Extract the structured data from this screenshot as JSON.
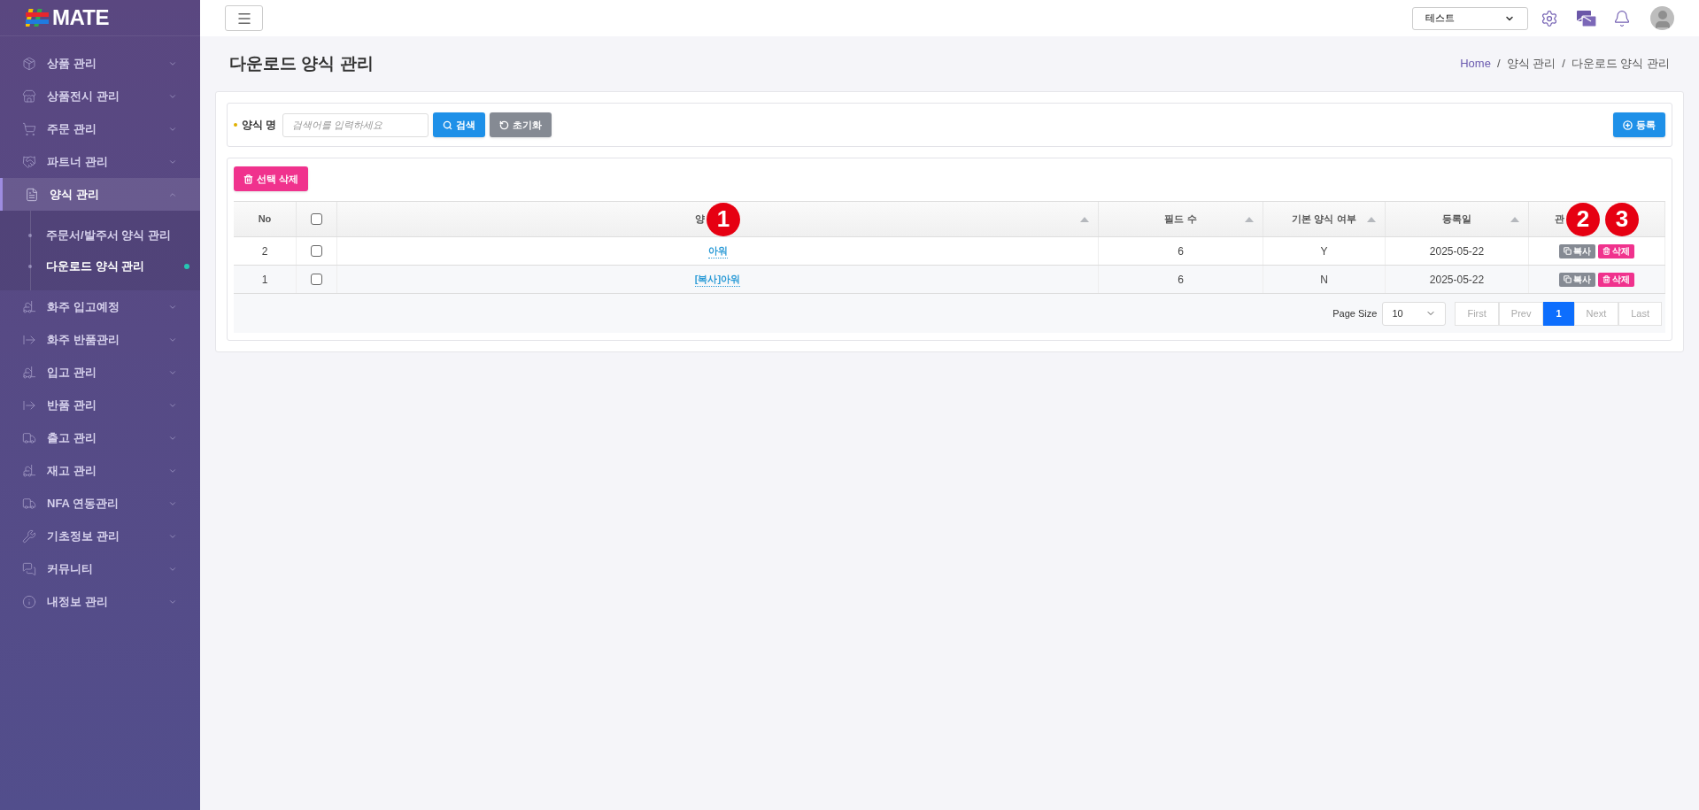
{
  "logo": {
    "text": "MATE"
  },
  "sidebar": {
    "items": [
      {
        "label": "상품 관리",
        "selected": false,
        "expanded": false
      },
      {
        "label": "상품전시 관리",
        "selected": false,
        "expanded": false
      },
      {
        "label": "주문 관리",
        "selected": false,
        "expanded": false
      },
      {
        "label": "파트너 관리",
        "selected": false,
        "expanded": false
      },
      {
        "label": "양식 관리",
        "selected": true,
        "expanded": true,
        "children": [
          {
            "label": "주문서/발주서 양식 관리",
            "selected": false
          },
          {
            "label": "다운로드 양식 관리",
            "selected": true
          }
        ]
      },
      {
        "label": "화주 입고예정",
        "selected": false,
        "expanded": false
      },
      {
        "label": "화주 반품관리",
        "selected": false,
        "expanded": false
      },
      {
        "label": "입고 관리",
        "selected": false,
        "expanded": false
      },
      {
        "label": "반품 관리",
        "selected": false,
        "expanded": false
      },
      {
        "label": "출고 관리",
        "selected": false,
        "expanded": false
      },
      {
        "label": "재고 관리",
        "selected": false,
        "expanded": false
      },
      {
        "label": "NFA 연동관리",
        "selected": false,
        "expanded": false
      },
      {
        "label": "기초정보 관리",
        "selected": false,
        "expanded": false
      },
      {
        "label": "커뮤니티",
        "selected": false,
        "expanded": false
      },
      {
        "label": "내정보 관리",
        "selected": false,
        "expanded": false
      }
    ]
  },
  "topbar": {
    "company_select": {
      "value": "테스트"
    }
  },
  "page": {
    "title": "다운로드 양식 관리",
    "breadcrumb": [
      {
        "label": "Home",
        "kind": "link"
      },
      {
        "label": "/",
        "kind": "separator"
      },
      {
        "label": "양식 관리",
        "kind": "text"
      },
      {
        "label": "/",
        "kind": "separator"
      },
      {
        "label": "다운로드 양식 관리",
        "kind": "text"
      }
    ]
  },
  "search": {
    "label": "양식 명",
    "placeholder": "검색어를 입력하세요",
    "search_button": "검색",
    "reset_button": "초기화",
    "register_button": "등록"
  },
  "table": {
    "delete_selected_button": "선택 삭제",
    "columns": [
      {
        "label": "No",
        "kind": "text",
        "sortable": false
      },
      {
        "kind": "checkbox",
        "checked": false,
        "sortable": false
      },
      {
        "label": "양",
        "kind": "text",
        "sortable": true,
        "markers": [
          "1"
        ]
      },
      {
        "label": "필드 수",
        "kind": "text",
        "sortable": true
      },
      {
        "label": "기본 양식 여부",
        "kind": "text",
        "sortable": true
      },
      {
        "label": "등록일",
        "kind": "text",
        "sortable": true
      },
      {
        "label": "관",
        "kind": "text",
        "sortable": false,
        "markers": [
          "2",
          "3"
        ]
      }
    ],
    "rows": [
      {
        "no": "2",
        "checked": false,
        "name": "아워",
        "fields": "6",
        "default": "Y",
        "date": "2025-05-22",
        "actions": [
          {
            "kind": "copy",
            "label": "복사"
          },
          {
            "kind": "delete",
            "label": "삭제"
          }
        ]
      },
      {
        "no": "1",
        "checked": false,
        "name": "[복사]아워",
        "fields": "6",
        "default": "N",
        "date": "2025-05-22",
        "actions": [
          {
            "kind": "copy",
            "label": "복사"
          },
          {
            "kind": "delete",
            "label": "삭제"
          }
        ]
      }
    ]
  },
  "pagination": {
    "page_size_label": "Page Size",
    "page_size": "10",
    "pages": [
      {
        "label": "First",
        "selected": false,
        "disabled": true
      },
      {
        "label": "Prev",
        "selected": false,
        "disabled": true
      },
      {
        "label": "1",
        "selected": true,
        "disabled": false
      },
      {
        "label": "Next",
        "selected": false,
        "disabled": true
      },
      {
        "label": "Last",
        "selected": false,
        "disabled": true
      }
    ]
  }
}
